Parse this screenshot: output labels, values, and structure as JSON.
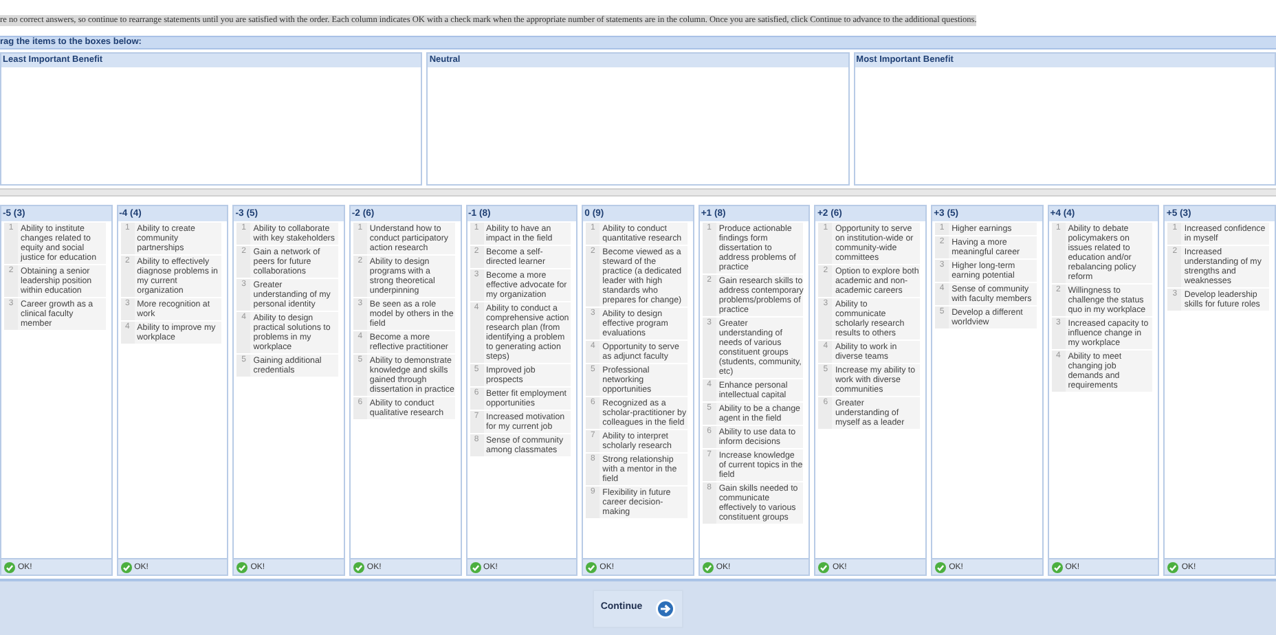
{
  "instructions": "re no correct answers, so continue to rearrange statements until you are satisfied with the order. Each column indicates OK with a check mark when the appropriate number of statements are in the column. Once you are satisfied, click Continue to advance to the additional questions.",
  "drag_header": "rag the items to the boxes below:",
  "boxes": [
    {
      "title": "Least Important Benefit"
    },
    {
      "title": "Neutral"
    },
    {
      "title": "Most Important Benefit"
    }
  ],
  "columns": [
    {
      "title": "-5 (3)",
      "ok": true,
      "status": "OK!",
      "items": [
        {
          "number": "1",
          "text": "Ability to institute changes related to equity and social justice for education"
        },
        {
          "number": "2",
          "text": "Obtaining a senior leadership position within education"
        },
        {
          "number": "3",
          "text": "Career growth as a clinical faculty member"
        }
      ]
    },
    {
      "title": "-4 (4)",
      "ok": true,
      "status": "OK!",
      "items": [
        {
          "number": "1",
          "text": "Ability to create community partnerships"
        },
        {
          "number": "2",
          "text": "Ability to effectively diagnose problems in my current organization"
        },
        {
          "number": "3",
          "text": "More recognition at work"
        },
        {
          "number": "4",
          "text": "Ability to improve my workplace"
        }
      ]
    },
    {
      "title": "-3 (5)",
      "ok": true,
      "status": "OK!",
      "items": [
        {
          "number": "1",
          "text": "Ability to collaborate with key stakeholders"
        },
        {
          "number": "2",
          "text": "Gain a network of peers for future collaborations"
        },
        {
          "number": "3",
          "text": "Greater understanding of my personal identity"
        },
        {
          "number": "4",
          "text": "Ability to design practical solutions to problems in my workplace"
        },
        {
          "number": "5",
          "text": "Gaining additional credentials"
        }
      ]
    },
    {
      "title": "-2 (6)",
      "ok": true,
      "status": "OK!",
      "items": [
        {
          "number": "1",
          "text": "Understand how to conduct participatory action research"
        },
        {
          "number": "2",
          "text": "Ability to design programs with a strong theoretical underpinning"
        },
        {
          "number": "3",
          "text": "Be seen as a role model by others in the field"
        },
        {
          "number": "4",
          "text": "Become a more reflective practitioner"
        },
        {
          "number": "5",
          "text": "Ability to demonstrate knowledge and skills gained through dissertation in practice"
        },
        {
          "number": "6",
          "text": "Ability to conduct qualitative research"
        }
      ]
    },
    {
      "title": "-1 (8)",
      "ok": true,
      "status": "OK!",
      "items": [
        {
          "number": "1",
          "text": "Ability to have an impact in the field"
        },
        {
          "number": "2",
          "text": "Become a self-directed learner"
        },
        {
          "number": "3",
          "text": "Become a more effective advocate for my organization"
        },
        {
          "number": "4",
          "text": "Ability to conduct a comprehensive action research plan (from identifying a problem to generating action steps)"
        },
        {
          "number": "5",
          "text": "Improved job prospects"
        },
        {
          "number": "6",
          "text": "Better fit employment opportunities"
        },
        {
          "number": "7",
          "text": "Increased motivation for my current job"
        },
        {
          "number": "8",
          "text": "Sense of community among classmates"
        }
      ]
    },
    {
      "title": "0 (9)",
      "ok": true,
      "status": "OK!",
      "items": [
        {
          "number": "1",
          "text": "Ability to conduct quantitative research"
        },
        {
          "number": "2",
          "text": "Become viewed as a steward of the practice (a dedicated leader with high standards who prepares for change)"
        },
        {
          "number": "3",
          "text": "Ability to design effective program evaluations"
        },
        {
          "number": "4",
          "text": "Opportunity to serve as adjunct faculty"
        },
        {
          "number": "5",
          "text": "Professional networking opportunities"
        },
        {
          "number": "6",
          "text": "Recognized as a scholar-practitioner by colleagues in the field"
        },
        {
          "number": "7",
          "text": "Ability to interpret scholarly research"
        },
        {
          "number": "8",
          "text": "Strong relationship with a mentor in the field"
        },
        {
          "number": "9",
          "text": "Flexibility in future career decision-making"
        }
      ]
    },
    {
      "title": "+1 (8)",
      "ok": true,
      "status": "OK!",
      "items": [
        {
          "number": "1",
          "text": "Produce actionable findings form dissertation to address problems of practice"
        },
        {
          "number": "2",
          "text": "Gain research skills to address contemporary problems/problems of practice"
        },
        {
          "number": "3",
          "text": "Greater understanding of needs of various constituent groups (students, community, etc)"
        },
        {
          "number": "4",
          "text": "Enhance personal intellectual capital"
        },
        {
          "number": "5",
          "text": "Ability to be a change agent in the field"
        },
        {
          "number": "6",
          "text": "Ability to use data to inform decisions"
        },
        {
          "number": "7",
          "text": "Increase knowledge of current topics in the field"
        },
        {
          "number": "8",
          "text": "Gain skills needed to communicate effectively to various constituent groups"
        }
      ]
    },
    {
      "title": "+2 (6)",
      "ok": true,
      "status": "OK!",
      "items": [
        {
          "number": "1",
          "text": "Opportunity to serve on institution-wide or community-wide committees"
        },
        {
          "number": "2",
          "text": "Option to explore both academic and non-academic careers"
        },
        {
          "number": "3",
          "text": "Ability to communicate scholarly research results to others"
        },
        {
          "number": "4",
          "text": "Ability to work in diverse teams"
        },
        {
          "number": "5",
          "text": "Increase my ability to work with diverse communities"
        },
        {
          "number": "6",
          "text": "Greater understanding of myself as a leader"
        }
      ]
    },
    {
      "title": "+3 (5)",
      "ok": true,
      "status": "OK!",
      "items": [
        {
          "number": "1",
          "text": "Higher earnings"
        },
        {
          "number": "2",
          "text": "Having a more meaningful career"
        },
        {
          "number": "3",
          "text": "Higher long-term earning potential"
        },
        {
          "number": "4",
          "text": "Sense of community with faculty members"
        },
        {
          "number": "5",
          "text": "Develop a different worldview"
        }
      ]
    },
    {
      "title": "+4 (4)",
      "ok": true,
      "status": "OK!",
      "items": [
        {
          "number": "1",
          "text": "Ability to debate policymakers on issues related to education and/or rebalancing policy reform"
        },
        {
          "number": "2",
          "text": "Willingness to challenge the status quo in my workplace"
        },
        {
          "number": "3",
          "text": "Increased capacity to influence change in my workplace"
        },
        {
          "number": "4",
          "text": "Ability to meet changing job demands and requirements"
        }
      ]
    },
    {
      "title": "+5 (3)",
      "ok": true,
      "status": "OK!",
      "items": [
        {
          "number": "1",
          "text": "Increased confidence in myself"
        },
        {
          "number": "2",
          "text": "Increased understanding of my strengths and weaknesses"
        },
        {
          "number": "3",
          "text": "Develop leadership skills for future roles"
        }
      ]
    }
  ],
  "continue_button": {
    "label": "Continue"
  }
}
